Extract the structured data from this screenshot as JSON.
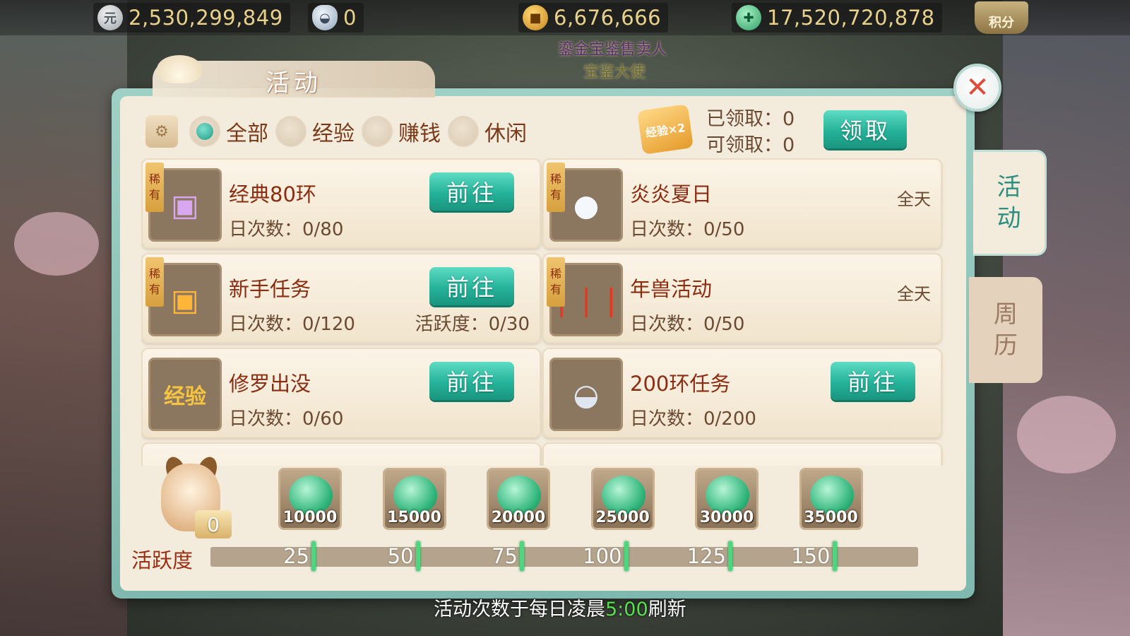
{
  "currencies": {
    "silver": {
      "icon": "silver-coin-icon",
      "value": "2,530,299,849"
    },
    "ingot": {
      "icon": "ingot-icon",
      "value": "0"
    },
    "coin": {
      "icon": "gold-coin-icon",
      "value": "6,676,666"
    },
    "jade": {
      "icon": "jade-icon",
      "value": "17,520,720,878"
    }
  },
  "score_button": {
    "label": "积分"
  },
  "npc": {
    "name": "鎏金宝鉴售卖人",
    "title": "宝鉴大使"
  },
  "window": {
    "title": "活动"
  },
  "side_tabs": [
    {
      "label": "活动",
      "active": true
    },
    {
      "label": "周历",
      "active": false
    }
  ],
  "filters": [
    {
      "label": "全部",
      "selected": true
    },
    {
      "label": "经验",
      "selected": false
    },
    {
      "label": "赚钱",
      "selected": false
    },
    {
      "label": "休闲",
      "selected": false
    }
  ],
  "claim": {
    "claimed_label": "已领取：0",
    "claimable_label": "可领取：0",
    "button_label": "领取",
    "badge": "经验×2"
  },
  "activities": [
    {
      "name": "经典80环",
      "count": "日次数：0/80",
      "rare": "稀有",
      "button": "前往",
      "icon": "purple-chest-icon",
      "accent": "#b36ad6"
    },
    {
      "name": "炎炎夏日",
      "count": "日次数：0/50",
      "rare": "稀有",
      "time": "全天",
      "icon": "snowball-icon",
      "accent": "#e9eef5"
    },
    {
      "name": "新手任务",
      "count": "日次数：0/120",
      "rare": "稀有",
      "button": "前往",
      "extra": "活跃度：0/30",
      "icon": "gold-chest-icon",
      "accent": "#f0a030"
    },
    {
      "name": "年兽活动",
      "count": "日次数：0/50",
      "rare": "稀有",
      "time": "全天",
      "icon": "firecracker-icon",
      "accent": "#d42a1a"
    },
    {
      "name": "修罗出没",
      "count": "日次数：0/60",
      "button": "前往",
      "icon": "exp-pouch-icon",
      "icon_text": "经验",
      "accent": "#e8b53a"
    },
    {
      "name": "200环任务",
      "count": "日次数：0/200",
      "button": "前往",
      "icon": "silver-ingot-tray-icon",
      "accent": "#c9d4e2"
    }
  ],
  "activity_points": {
    "label": "活跃度",
    "current": "0",
    "max": 150,
    "milestones": [
      {
        "points": "25",
        "reward": "10000"
      },
      {
        "points": "50",
        "reward": "15000"
      },
      {
        "points": "75",
        "reward": "20000"
      },
      {
        "points": "100",
        "reward": "25000"
      },
      {
        "points": "125",
        "reward": "30000"
      },
      {
        "points": "150",
        "reward": "35000"
      }
    ]
  },
  "refresh_note": {
    "prefix": "活动次数于每日凌晨",
    "time": "5:00",
    "suffix": "刷新"
  }
}
